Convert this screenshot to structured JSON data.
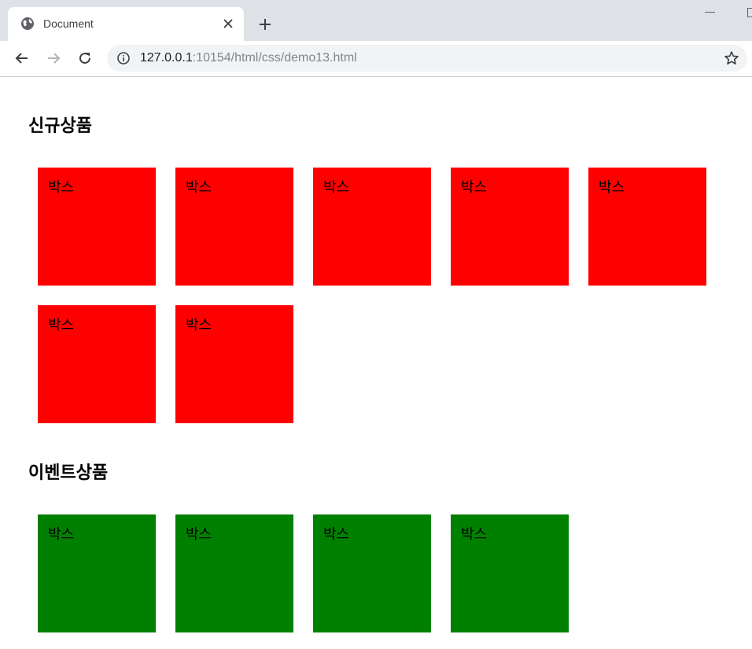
{
  "browser": {
    "tab_title": "Document",
    "url_host": "127.0.0.1",
    "url_path": ":10154/html/css/demo13.html"
  },
  "page": {
    "sections": [
      {
        "heading": "신규상품",
        "box_color": "#ff0000",
        "boxes": [
          "박스",
          "박스",
          "박스",
          "박스",
          "박스",
          "박스",
          "박스"
        ]
      },
      {
        "heading": "이벤트상품",
        "box_color": "#008000",
        "boxes": [
          "박스",
          "박스",
          "박스",
          "박스"
        ]
      }
    ]
  }
}
